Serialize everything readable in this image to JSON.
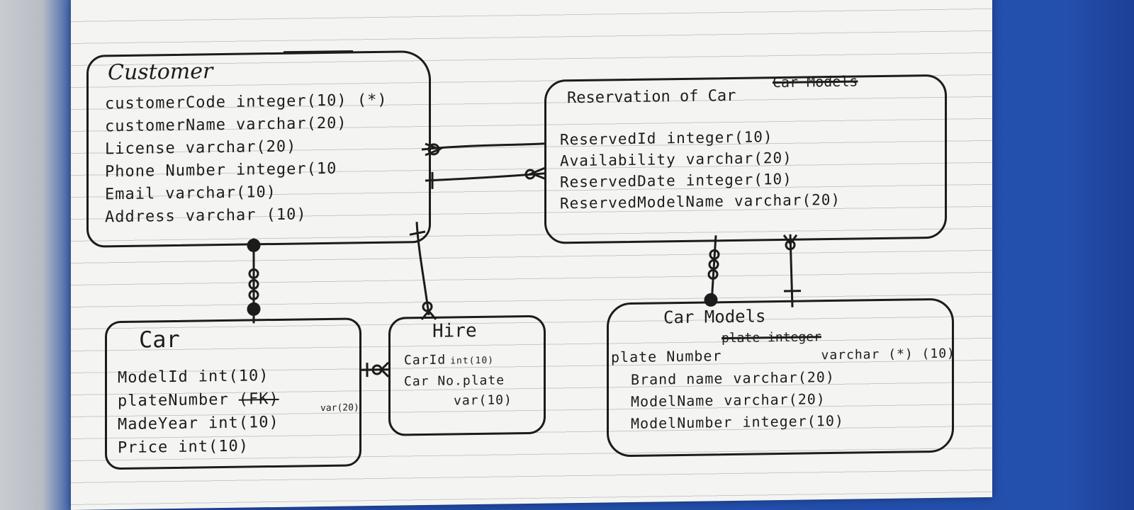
{
  "diagram": {
    "customer": {
      "title": "Customer",
      "attributes": [
        {
          "name": "customerCode",
          "type": "integer(10) (*)"
        },
        {
          "name": "customerName",
          "type": "varchar(20)"
        },
        {
          "name": "License",
          "type": "varchar(20)"
        },
        {
          "name": "Phone Number",
          "type": "integer(10"
        },
        {
          "name": "Email",
          "type": "varchar(10)"
        },
        {
          "name": "Address",
          "type": "varchar (10)"
        }
      ]
    },
    "reservation": {
      "title": "Reservation of Car",
      "title_struck": "Car Models",
      "attributes": [
        {
          "name": "ReservedId",
          "type": "integer(10)"
        },
        {
          "name": "Availability",
          "type": "varchar(20)"
        },
        {
          "name": "ReservedDate",
          "type": "integer(10)"
        },
        {
          "name": "ReservedModelName",
          "type": "varchar(20)"
        }
      ]
    },
    "car": {
      "title": "Car",
      "attributes": [
        {
          "name": "ModelId",
          "type": "int(10)"
        },
        {
          "name": "plateNumber",
          "type": "(FK)"
        },
        {
          "name": "MadeYear",
          "type": "int(10)"
        },
        {
          "name": "Price",
          "type": "int(10)"
        }
      ],
      "plate_type_note": "var(20)"
    },
    "hire": {
      "title": "Hire",
      "attributes": [
        {
          "name": "CarId",
          "type": "int(10)"
        },
        {
          "name": "Car No.plate",
          "type": "var(10)"
        }
      ]
    },
    "car_models": {
      "title": "Car Models",
      "attributes": [
        {
          "name": "plate Number",
          "type": "varchar (*) (10)"
        },
        {
          "name": "Brand name",
          "type": "varchar(20)"
        },
        {
          "name": "ModelName",
          "type": "varchar(20)"
        },
        {
          "name": "ModelNumber",
          "type": "integer(10)"
        }
      ],
      "struck_words": "plate integer"
    }
  },
  "colors": {
    "ink": "#1c1c1c",
    "paper": "#f4f4f2",
    "rule_lines": "#c9c9c9",
    "background": "#2450ad"
  }
}
